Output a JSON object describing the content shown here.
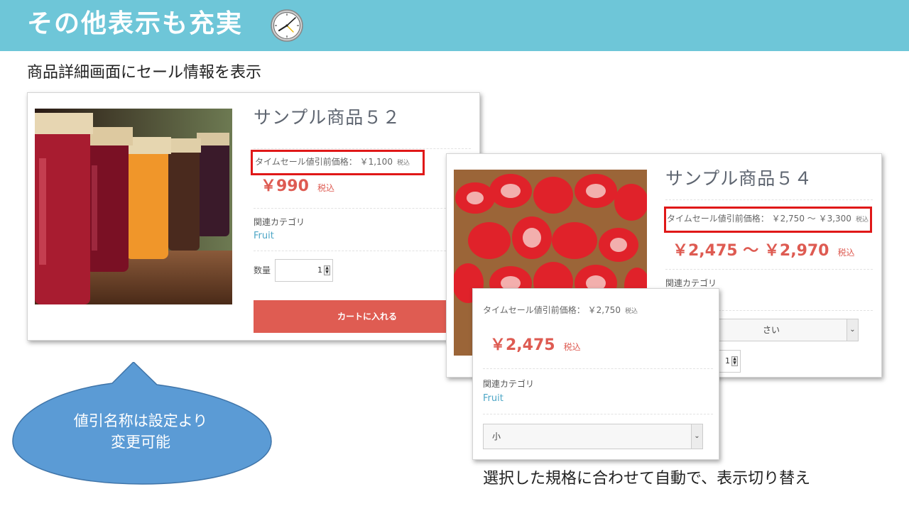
{
  "slide": {
    "title": "その他表示も充実",
    "subtitle": "商品詳細画面にセール情報を表示",
    "caption": "選択した規格に合わせて自動で、表示切り替え",
    "callout": [
      "値引名称は設定より",
      "変更可能"
    ]
  },
  "product1": {
    "name": "サンプル商品５２",
    "pre_label": "タイムセール値引前価格：",
    "pre_price": "￥1,100",
    "tax": "税込",
    "price": "￥990",
    "category_label": "関連カテゴリ",
    "category": "Fruit",
    "qty_label": "数量",
    "qty": "1",
    "cart_button": "カートに入れる"
  },
  "product2": {
    "name": "サンプル商品５４",
    "pre_label": "タイムセール値引前価格：",
    "pre_price": "￥2,750 ～ ￥3,300",
    "tax": "税込",
    "price": "￥2,475 ～ ￥2,970",
    "category_label": "関連カテゴリ",
    "select_partial": "さい",
    "qty_partial": "1"
  },
  "product2_selected": {
    "pre_label": "タイムセール値引前価格：",
    "pre_price": "￥2,750",
    "tax": "税込",
    "price": "￥2,475",
    "category_label": "関連カテゴリ",
    "category": "Fruit",
    "select_value": "小"
  },
  "colors": {
    "header": "#6ec6d8",
    "sale_price": "#de5b52",
    "highlight_box": "#e01818",
    "link": "#4da6c6",
    "callout": "#5b9bd5"
  }
}
